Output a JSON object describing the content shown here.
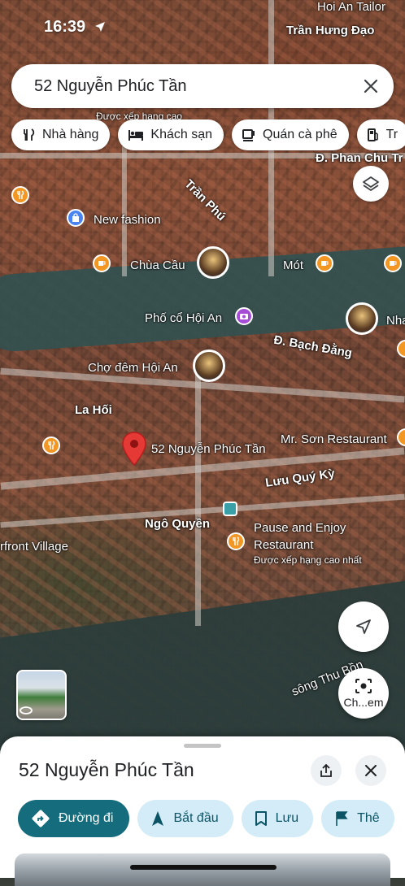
{
  "status": {
    "time": "16:39"
  },
  "search": {
    "query": "52 Nguyễn Phúc Tần"
  },
  "chips": [
    {
      "label": "Nhà hàng",
      "icon": "restaurant-icon"
    },
    {
      "label": "Khách sạn",
      "icon": "hotel-icon"
    },
    {
      "label": "Quán cà phê",
      "icon": "coffee-icon"
    },
    {
      "label": "Tr",
      "icon": "gas-station-icon"
    }
  ],
  "map": {
    "labels": {
      "hoi_an_tailor": "Hoi An Tailor",
      "tran_hung_dao": "Trần Hưng Đạo",
      "duoc_xep_hang_top": "Được xếp hạng cao",
      "phan_chu_trinh": "Đ. Phan Chu Tr",
      "tran_phu": "Trần Phú",
      "new_fashion": "New fashion",
      "chua_cau": "Chùa Cầu",
      "mot": "Mót",
      "pho_co_hoi_an": "Phố cổ Hội An",
      "nha": "Nha",
      "bach_dang": "Đ. Bạch Đằng",
      "cho_dem": "Chợ đêm Hội An",
      "la_hoi": "La Hối",
      "pin_address": "52 Nguyễn Phúc Tần",
      "mr_son": "Mr. Sơn Restaurant",
      "luu_quy_ky": "Lưu Quý Kỳ",
      "ngo_quyen": "Ngô Quyền",
      "pause_enjoy_1": "Pause and Enjoy",
      "pause_enjoy_2": "Restaurant",
      "duoc_xep_hang": "Được xếp hạng cao nhất",
      "riverfront": "rfront Village",
      "song_thu_bon": "sông Thu Bồn"
    }
  },
  "buttons": {
    "lens_label": "Ch...em"
  },
  "sheet": {
    "title": "52 Nguyễn Phúc Tần",
    "actions": [
      {
        "label": "Đường đi",
        "icon": "directions-icon"
      },
      {
        "label": "Bắt đầu",
        "icon": "navigation-arrow-icon"
      },
      {
        "label": "Lưu",
        "icon": "bookmark-icon"
      },
      {
        "label": "Thê",
        "icon": "flag-icon"
      }
    ]
  },
  "colors": {
    "primary_action": "#146c7c",
    "secondary_action": "#d3ecf7",
    "pin_red": "#e53935",
    "poi_orange": "#f29624"
  }
}
